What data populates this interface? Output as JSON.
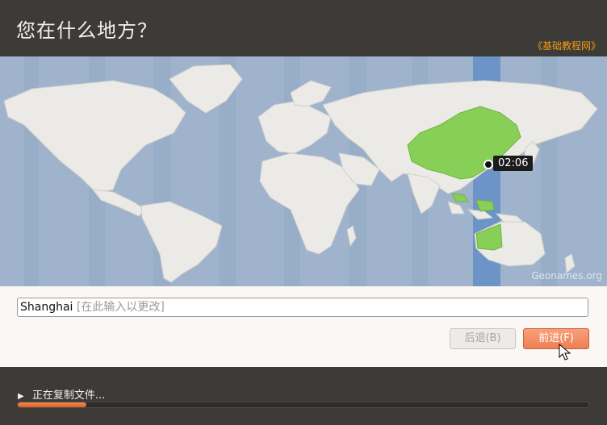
{
  "header": {
    "title": "您在什么地方？",
    "watermark": "《基础教程网》"
  },
  "map": {
    "credit": "Geonames.org",
    "time": "02:06",
    "highlight_color": "#88cf58",
    "selected_timezone_color": "#6d94c6"
  },
  "location": {
    "city": "Shanghai",
    "hint": "[在此输入以更改]"
  },
  "buttons": {
    "back_label": "后退(B)",
    "forward_label": "前进(F)"
  },
  "install": {
    "status": "正在复制文件...",
    "progress": 0.12
  },
  "colors": {
    "accent": "#ef7f53"
  }
}
